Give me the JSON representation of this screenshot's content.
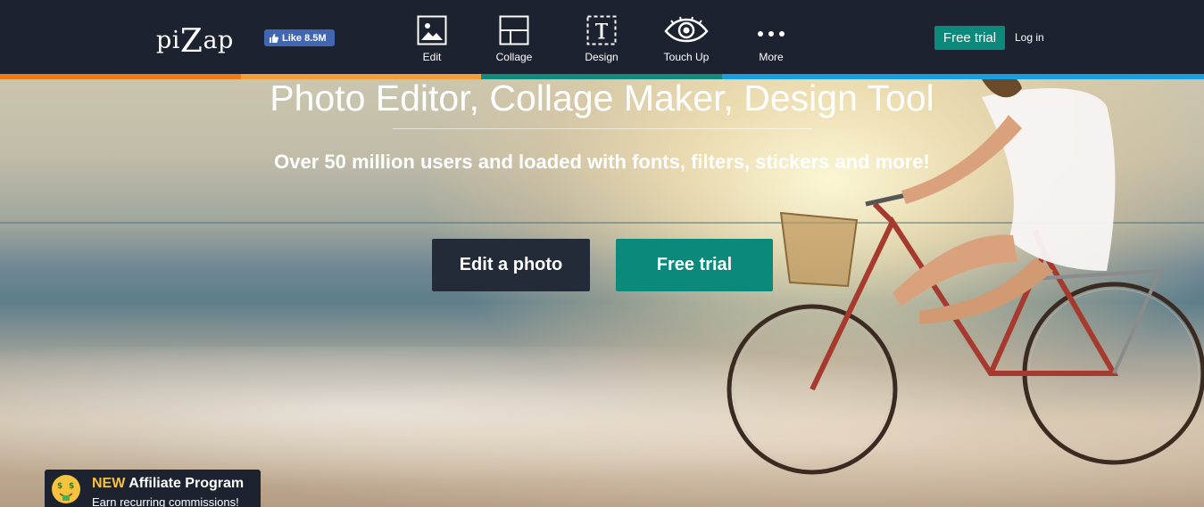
{
  "logo": {
    "pre": "pi",
    "big": "Z",
    "post": "ap"
  },
  "facebook": {
    "like_label": "Like 8.5M"
  },
  "tools": [
    {
      "label": "Edit",
      "icon": "image-icon"
    },
    {
      "label": "Collage",
      "icon": "collage-icon"
    },
    {
      "label": "Design",
      "icon": "text-icon"
    },
    {
      "label": "Touch Up",
      "icon": "eye-icon"
    },
    {
      "label": "More",
      "icon": "more-dots-icon"
    }
  ],
  "header_actions": {
    "free_trial": "Free trial",
    "login": "Log in"
  },
  "stripe_colors": [
    "#f07b17",
    "#f4a03a",
    "#138a7e",
    "#1a9fe0"
  ],
  "hero": {
    "headline": "Photo Editor, Collage Maker, Design Tool",
    "subline": "Over 50 million users and loaded with fonts, filters, stickers and more!",
    "edit_button": "Edit a photo",
    "trial_button": "Free trial"
  },
  "affiliate": {
    "badge": "NEW",
    "title": "Affiliate Program",
    "subtitle": "Earn recurring commissions!",
    "icon": "money-face-icon"
  },
  "colors": {
    "nav_bg": "#1d2230",
    "accent": "#0b8a7c",
    "badge": "#f7c23c"
  }
}
